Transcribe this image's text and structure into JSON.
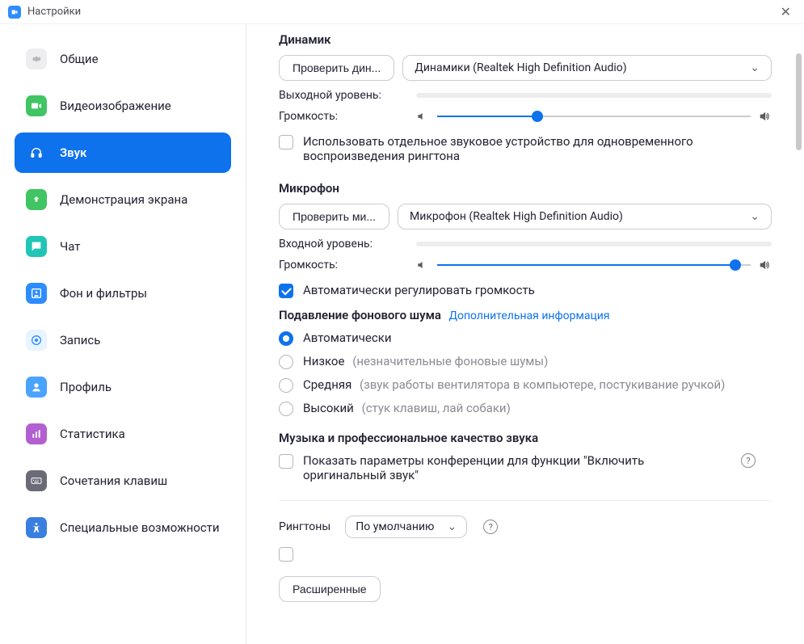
{
  "window": {
    "title": "Настройки"
  },
  "sidebar": {
    "items": [
      {
        "label": "Общие"
      },
      {
        "label": "Видеоизображение"
      },
      {
        "label": "Звук"
      },
      {
        "label": "Демонстрация экрана"
      },
      {
        "label": "Чат"
      },
      {
        "label": "Фон и фильтры"
      },
      {
        "label": "Запись"
      },
      {
        "label": "Профиль"
      },
      {
        "label": "Статистика"
      },
      {
        "label": "Сочетания клавиш"
      },
      {
        "label": "Специальные возможности"
      }
    ]
  },
  "speaker": {
    "title": "Динамик",
    "test_btn": "Проверить дин...",
    "device": "Динамики (Realtek High Definition Audio)",
    "output_level_label": "Выходной уровень:",
    "volume_label": "Громкость:",
    "volume_pct": 32,
    "separate_device": "Использовать отдельное звуковое устройство для одновременного воспроизведения рингтона"
  },
  "mic": {
    "title": "Микрофон",
    "test_btn": "Проверить ми...",
    "device": "Микрофон (Realtek High Definition Audio)",
    "input_level_label": "Входной уровень:",
    "volume_label": "Громкость:",
    "volume_pct": 95,
    "auto_adjust": "Автоматически регулировать громкость"
  },
  "noise": {
    "title": "Подавление фонового шума",
    "link": "Дополнительная информация",
    "opt_auto": "Автоматически",
    "opt_low": "Низкое",
    "opt_low_hint": "(незначительные фоновые шумы)",
    "opt_med": "Средняя",
    "opt_med_hint": "(звук работы вентилятора в компьютере, постукивание ручкой)",
    "opt_high": "Высокий",
    "opt_high_hint": "(стук клавиш, лай собаки)"
  },
  "music": {
    "title": "Музыка и профессиональное качество звука",
    "show_original": "Показать параметры конференции для функции \"Включить оригинальный звук\""
  },
  "ringtone": {
    "label": "Рингтоны",
    "value": "По умолчанию"
  },
  "advanced_btn": "Расширенные"
}
